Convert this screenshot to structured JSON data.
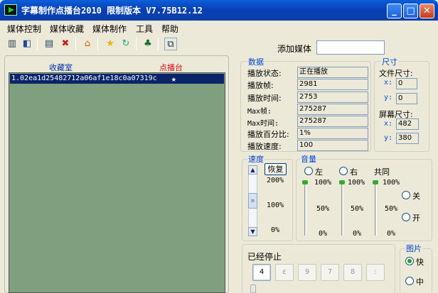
{
  "window": {
    "title": "字幕制作点播台2010  限制版本  V7.75B12.12",
    "minimize": "_",
    "maximize": "□",
    "close": "✕"
  },
  "menu": [
    "媒体控制",
    "媒体收藏",
    "媒体制作",
    "工具",
    "帮助"
  ],
  "toolbar_icons": [
    "film-icon",
    "panel-icon",
    "edit-icon",
    "delete-icon",
    "home-icon",
    "star-icon",
    "refresh-icon",
    "tree-icon",
    "window-icon"
  ],
  "playlist": {
    "tab_favorites": "收藏室",
    "tab_ondemand": "点播台",
    "items": [
      {
        "name": "1.02ea1d25482712a06af1e18c0a07319c",
        "mark": "★"
      }
    ]
  },
  "add_media": {
    "label": "添加媒体",
    "value": ""
  },
  "data_group": {
    "title": "数据",
    "rows": [
      {
        "label": "播放状态:",
        "value": "正在播放"
      },
      {
        "label": "播放帧:",
        "value": "2981"
      },
      {
        "label": "播放时间:",
        "value": "2753"
      },
      {
        "label": "Max帧:",
        "value": "275287"
      },
      {
        "label": "Max时间:",
        "value": "275287"
      },
      {
        "label": "播放百分比:",
        "value": "1%"
      },
      {
        "label": "播放速度:",
        "value": "100"
      }
    ]
  },
  "size_group": {
    "title": "尺寸",
    "file_size_label": "文件尺寸:",
    "file_x_label": "x:",
    "file_x": "0",
    "file_y_label": "y:",
    "file_y": "0",
    "screen_size_label": "屏幕尺寸:",
    "screen_x_label": "x:",
    "screen_x": "482",
    "screen_y_label": "y:",
    "screen_y": "380"
  },
  "speed_group": {
    "title": "速度",
    "reset_button": "恢复",
    "max": "200%",
    "mid": "100%",
    "min": "0%"
  },
  "volume_group": {
    "title": "音量",
    "left_label": "左",
    "right_label": "右",
    "common_label": "共同",
    "off_label": "关",
    "on_label": "开",
    "max": "100%",
    "mid": "50%",
    "min": "0%"
  },
  "stopped_group": {
    "title": "已经停止",
    "buttons": [
      "4",
      "ε",
      "9",
      "7",
      "8",
      ":"
    ]
  },
  "picture_group": {
    "title": "图片",
    "fast_label": "快",
    "medium_label": "中"
  }
}
